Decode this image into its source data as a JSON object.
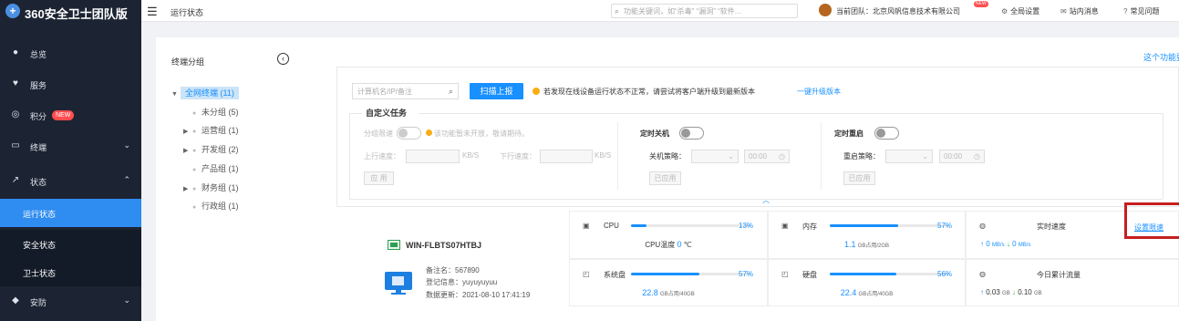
{
  "brand": {
    "logo_glyph": "+",
    "name": "360安全卫士团队版"
  },
  "header": {
    "page_title": "运行状态",
    "search_placeholder": "功能关键词，如“杀毒” “漏洞” “软件...",
    "team_label": "当前团队：北京风帆信息技术有限公司",
    "new_badge": "NEW",
    "links": [
      {
        "icon": "gear-icon",
        "glyph": "⚙",
        "label": "全局设置"
      },
      {
        "icon": "mail-icon",
        "glyph": "✉",
        "label": "站内消息"
      },
      {
        "icon": "help-icon",
        "glyph": "?",
        "label": "常见问题"
      }
    ]
  },
  "sidebar": {
    "items": [
      {
        "key": "overview",
        "label": "总览",
        "glyph": "●"
      },
      {
        "key": "service",
        "label": "服务",
        "glyph": "♥"
      },
      {
        "key": "points",
        "label": "积分",
        "glyph": "◎",
        "badge": "NEW"
      },
      {
        "key": "terminal",
        "label": "终端",
        "glyph": "▭",
        "chevron": "⌄"
      },
      {
        "key": "status",
        "label": "状态",
        "glyph": "↗",
        "chevron": "⌃"
      }
    ],
    "sub_items": [
      {
        "label": "运行状态",
        "active": true
      },
      {
        "label": "安全状态",
        "active": false
      },
      {
        "label": "卫士状态",
        "active": false
      }
    ],
    "security": {
      "label": "安防",
      "glyph": "◆",
      "chevron": "⌄"
    }
  },
  "groups": {
    "title": "终端分组",
    "collapse_glyph": "‹",
    "root": "全网终端 (11)",
    "nodes": [
      {
        "label": "未分组 (5)",
        "expandable": false
      },
      {
        "label": "运营组 (1)",
        "expandable": true
      },
      {
        "label": "开发组 (2)",
        "expandable": true
      },
      {
        "label": "产品组 (1)",
        "expandable": false
      },
      {
        "label": "财务组 (1)",
        "expandable": true
      },
      {
        "label": "行政组 (1)",
        "expandable": false
      }
    ]
  },
  "toolbar": {
    "host_placeholder": "计算机名/IP/备注",
    "scan_label": "扫描上报",
    "warning": "若发现在线设备运行状态不正常，请尝试将客户端升级到最新版本",
    "upgrade_link": "一键升级版本",
    "right_notice": "这个功能要"
  },
  "custom_task": {
    "legend": "自定义任务",
    "throttle": {
      "label": "分组限速",
      "tip": "该功能暂未开放，敬请期待。",
      "up_label": "上行速度：",
      "down_label": "下行速度：",
      "unit": "KB/S",
      "apply": "应 用"
    },
    "shutdown": {
      "label": "定时关机",
      "strategy_label": "关机策略：",
      "time": "00:00",
      "applied": "已应用"
    },
    "reboot": {
      "label": "定时重启",
      "strategy_label": "重启策略：",
      "time": "00:00",
      "applied": "已应用"
    },
    "expand_glyph": "︿"
  },
  "device": {
    "name": "WIN-FLBTS07HTBJ",
    "remark": "备注名：567890",
    "login": "登记信息：yuyuyuyuu",
    "updated": "数据更新：2021-08-10 17:41:19",
    "cpu": {
      "label": "CPU",
      "percent": "13%",
      "fill": 0.13,
      "temp_label": "CPU温度",
      "temp_value": "0",
      "temp_unit": "℃"
    },
    "memory": {
      "label": "内存",
      "percent": "57%",
      "fill": 0.57,
      "used": "1.1",
      "detail": "GB占用/2GB"
    },
    "speed": {
      "label": "实时速度",
      "set_limit": "设置限速",
      "up": "0",
      "down": "0",
      "unit": "MB/s"
    },
    "system_disk": {
      "label": "系统盘",
      "percent": "57%",
      "fill": 0.57,
      "used": "22.8",
      "detail": "GB占用/40GB"
    },
    "disk": {
      "label": "硬盘",
      "percent": "56%",
      "fill": 0.56,
      "used": "22.4",
      "detail": "GB占用/40GB"
    },
    "traffic": {
      "label": "今日累计流量",
      "up": "0.03",
      "down": "0.10",
      "unit": "GB"
    }
  },
  "colors": {
    "accent": "#1890ff",
    "sidebar": "#1c2433",
    "active": "#2f8cf0",
    "highlight": "#c61f1f"
  }
}
